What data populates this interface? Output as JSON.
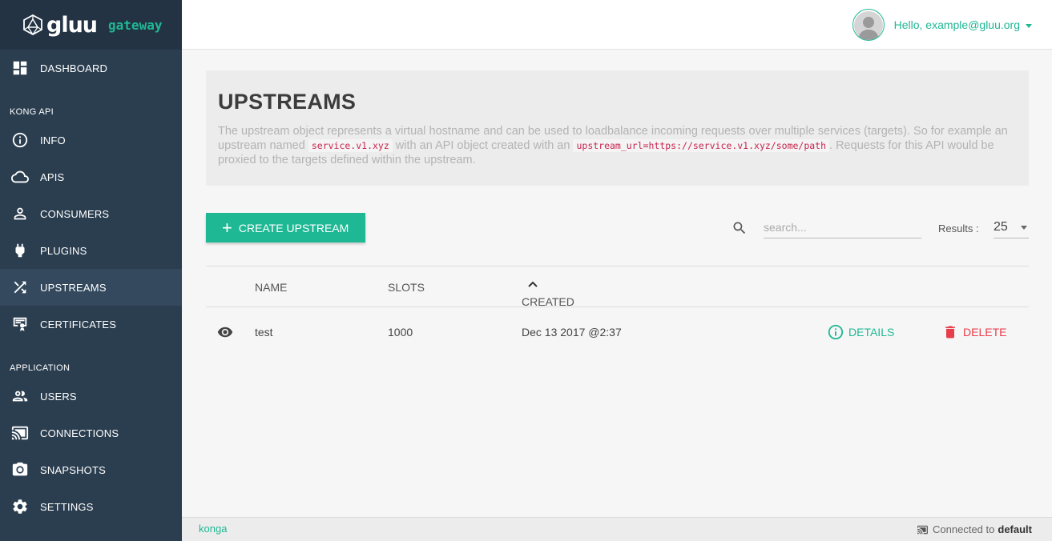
{
  "brand": {
    "name": "gluu",
    "sub": "gateway"
  },
  "sidebar": {
    "items": [
      {
        "label": "DASHBOARD",
        "icon": "dashboard-icon"
      },
      {
        "section": "KONG API"
      },
      {
        "label": "INFO",
        "icon": "info-icon"
      },
      {
        "label": "APIS",
        "icon": "cloud-icon"
      },
      {
        "label": "CONSUMERS",
        "icon": "person-icon"
      },
      {
        "label": "PLUGINS",
        "icon": "plug-icon"
      },
      {
        "label": "UPSTREAMS",
        "icon": "shuffle-icon",
        "active": true
      },
      {
        "label": "CERTIFICATES",
        "icon": "certificate-icon"
      },
      {
        "section": "APPLICATION"
      },
      {
        "label": "USERS",
        "icon": "users-icon"
      },
      {
        "label": "CONNECTIONS",
        "icon": "cast-icon"
      },
      {
        "label": "SNAPSHOTS",
        "icon": "camera-icon"
      },
      {
        "label": "SETTINGS",
        "icon": "gear-icon"
      }
    ]
  },
  "header": {
    "greeting": "Hello, example@gluu.org"
  },
  "page": {
    "title": "UPSTREAMS",
    "desc_part1": "The upstream object represents a virtual hostname and can be used to loadbalance incoming requests over multiple services (targets). So for example an upstream named ",
    "code1": "service.v1.xyz",
    "desc_part2": " with an API object created with an ",
    "code2": "upstream_url=https://service.v1.xyz/some/path",
    "desc_part3": ". Requests for this API would be proxied to the targets defined within the upstream."
  },
  "toolbar": {
    "create_label": "CREATE UPSTREAM",
    "search_placeholder": "search...",
    "results_label": "Results :",
    "results_value": "25"
  },
  "table": {
    "columns": {
      "name": "NAME",
      "slots": "SLOTS",
      "created": "CREATED"
    },
    "rows": [
      {
        "name": "test",
        "slots": "1000",
        "created": "Dec 13 2017 @2:37",
        "details": "DETAILS",
        "delete": "DELETE"
      }
    ]
  },
  "footer": {
    "brand": "konga",
    "connected": "Connected to",
    "target": "default"
  },
  "colors": {
    "accent": "#1fb894",
    "sidebar": "#2b3e50",
    "danger": "#e83e4c"
  }
}
